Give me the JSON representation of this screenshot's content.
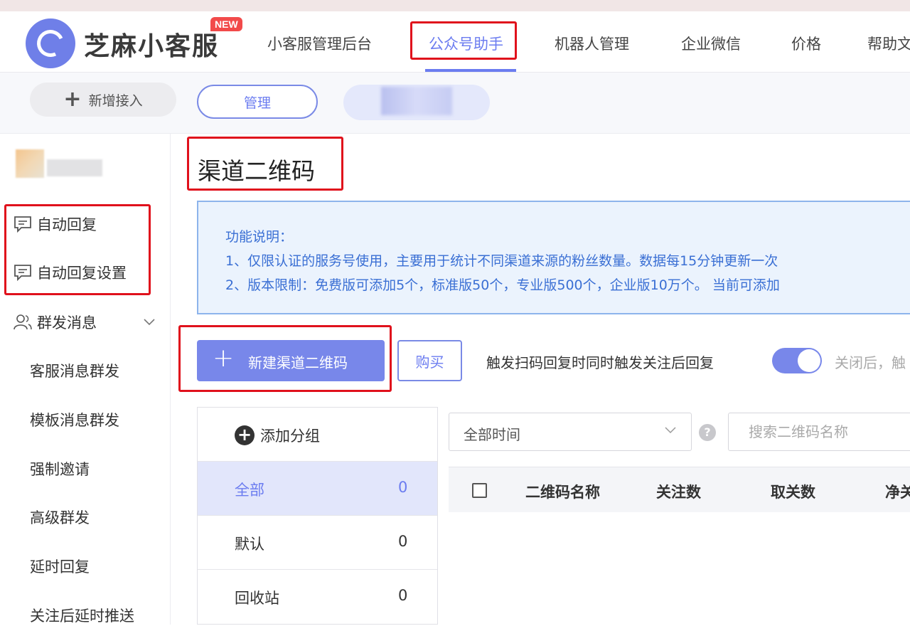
{
  "brand": {
    "name": "芝麻小客服",
    "badge": "NEW"
  },
  "nav": {
    "items": [
      {
        "label": "小客服管理后台"
      },
      {
        "label": "公众号助手"
      },
      {
        "label": "机器人管理"
      },
      {
        "label": "企业微信"
      },
      {
        "label": "价格"
      },
      {
        "label": "帮助文"
      }
    ],
    "active": "公众号助手"
  },
  "toolbar": {
    "add_access": "新增接入",
    "manage": "管理"
  },
  "sidebar": {
    "auto_reply": "自动回复",
    "auto_reply_settings": "自动回复设置",
    "mass_message": "群发消息",
    "sub_items": [
      {
        "label": "客服消息群发"
      },
      {
        "label": "模板消息群发"
      },
      {
        "label": "强制邀请"
      },
      {
        "label": "高级群发"
      },
      {
        "label": "延时回复"
      },
      {
        "label": "关注后延时推送"
      }
    ]
  },
  "page": {
    "title": "渠道二维码",
    "info": {
      "heading": "功能说明：",
      "line1": "1、仅限认证的服务号使用，主要用于统计不同渠道来源的粉丝数量。数据每15分钟更新一次",
      "line2": "2、版本限制：免费版可添加5个，标准版50个，专业版500个，企业版10万个。 当前可添加"
    },
    "new_qr_button": "新建渠道二维码",
    "buy_button": "购买",
    "trigger_label": "触发扫码回复时同时触发关注后回复",
    "toggle_on": true,
    "after_close": "关闭后，触",
    "add_group": "添加分组",
    "groups": [
      {
        "name": "全部",
        "count": "0"
      },
      {
        "name": "默认",
        "count": "0"
      },
      {
        "name": "回收站",
        "count": "0"
      }
    ],
    "time_filter": "全部时间",
    "help_glyph": "?",
    "search_placeholder": "搜索二维码名称",
    "table_headers": [
      "二维码名称",
      "关注数",
      "取关数",
      "净关"
    ]
  },
  "colors": {
    "accent": "#6b7cf0",
    "highlight_box": "#e0111c",
    "info_bg": "#ebf3fd"
  }
}
